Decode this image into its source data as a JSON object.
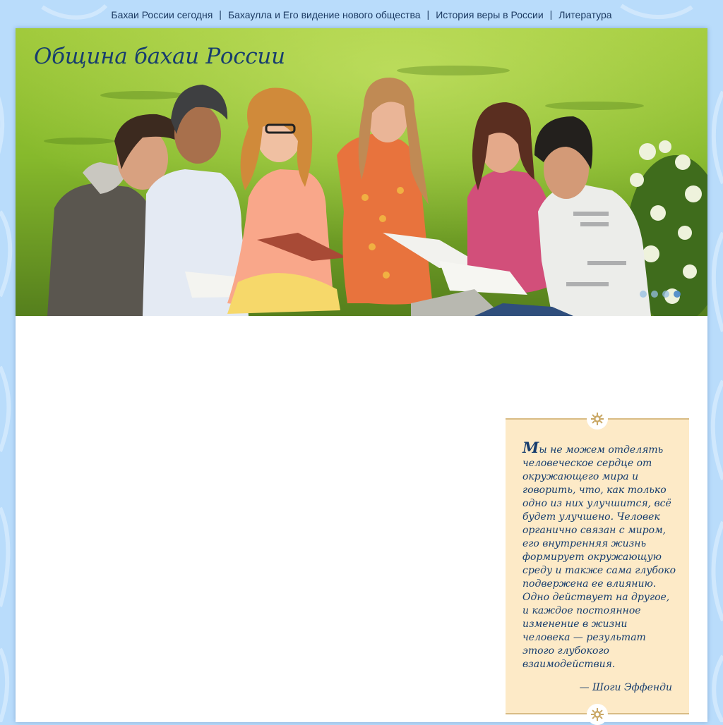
{
  "nav": {
    "items": [
      {
        "label": "Бахаи России сегодня"
      },
      {
        "label": "Бахаулла и Его видение нового общества"
      },
      {
        "label": "История веры в России"
      },
      {
        "label": "Литература"
      }
    ],
    "separator": "|"
  },
  "header": {
    "site_title": "Община бахаи России"
  },
  "hero": {
    "slide_count": 4,
    "active_slide": 4
  },
  "quote": {
    "first_letter": "М",
    "text_rest": "ы не можем отделять человеческое сердце от окружающего мира и говорить, что, как только одно из них улучшится, всё будет улучшено. Человек органично связан с миром, его внутренняя жизнь формирует окружающую среду и также сама глубоко подвержена ее влиянию. Одно действует на другое, и каждое постоянное изменение в жизни человека — результат этого глубокого взаимодействия.",
    "author": "— Шоги Эффенди"
  },
  "colors": {
    "page_background": "#b9dcfb",
    "title": "#173d6e",
    "quote_background": "#fdeac7",
    "quote_border": "#d9bc85"
  }
}
